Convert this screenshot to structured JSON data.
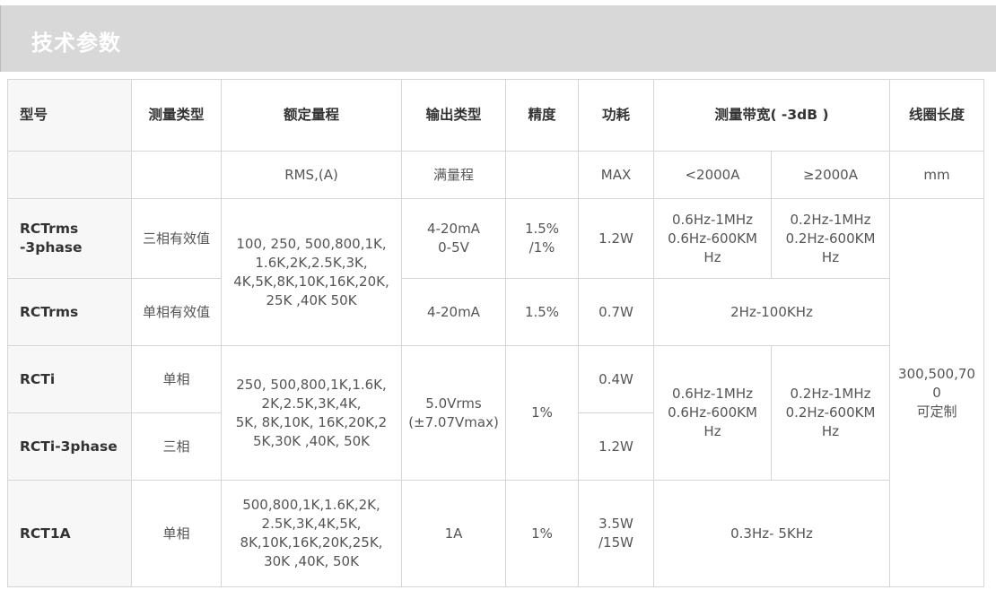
{
  "section_title": "技术参数",
  "header": {
    "model": "型号",
    "meas_type": "测量类型",
    "range": "额定量程",
    "output": "输出类型",
    "accuracy": "精度",
    "power": "功耗",
    "bandwidth": "测量带宽( -3dB )",
    "coil": "线圈长度"
  },
  "units": {
    "range": "RMS,(A)",
    "output": "满量程",
    "power": "MAX",
    "bw_low": "<2000A",
    "bw_high": "≥2000A",
    "coil": "mm"
  },
  "rows": {
    "rctrms3": {
      "model": [
        "RCTrms",
        "-3phase"
      ],
      "type": "三相有效值",
      "output": [
        "4-20mA",
        "0-5V"
      ],
      "accuracy": [
        "1.5%",
        "/1%"
      ],
      "power": "1.2W",
      "bw_low": [
        "0.6Hz-1MHz",
        "0.6Hz-600KM",
        "Hz"
      ],
      "bw_high": [
        "0.2Hz-1MHz",
        "0.2Hz-600KM",
        "Hz"
      ]
    },
    "rctrms": {
      "model": "RCTrms",
      "type": "单相有效值",
      "output": "4-20mA",
      "accuracy": "1.5%",
      "power": "0.7W",
      "bw": "2Hz-100KHz"
    },
    "rctrms_range": [
      "100, 250, 500,800,1K,",
      "1.6K,2K,2.5K,3K,",
      "4K,5K,8K,10K,16K,20K,",
      "25K ,40K 50K"
    ],
    "rcti": {
      "model": "RCTi",
      "type": "单相",
      "power": "0.4W"
    },
    "rcti3": {
      "model": "RCTi-3phase",
      "type": "三相",
      "power": "1.2W"
    },
    "rcti_range": [
      "250, 500,800,1K,1.6K,",
      "2K,2.5K,3K,4K,",
      "5K, 8K,10K, 16K,20K,2",
      "5K,30K ,40K, 50K"
    ],
    "rcti_output": [
      "5.0Vrms",
      "(±7.07Vmax)"
    ],
    "rcti_accuracy": "1%",
    "rcti_bw_low": [
      "0.6Hz-1MHz",
      "0.6Hz-600KM",
      "Hz"
    ],
    "rcti_bw_high": [
      "0.2Hz-1MHz",
      "0.2Hz-600KM",
      "Hz"
    ],
    "rct1a": {
      "model": "RCT1A",
      "type": "单相",
      "range": [
        "500,800,1K,1.6K,2K,",
        "2.5K,3K,4K,5K,",
        "8K,10K,16K,20K,25K,",
        "30K ,40K, 50K"
      ],
      "output": "1A",
      "accuracy": "1%",
      "power": [
        "3.5W",
        "/15W"
      ],
      "bw": "0.3Hz- 5KHz"
    },
    "coil_value": [
      "300,500,70",
      "0",
      "可定制"
    ]
  }
}
